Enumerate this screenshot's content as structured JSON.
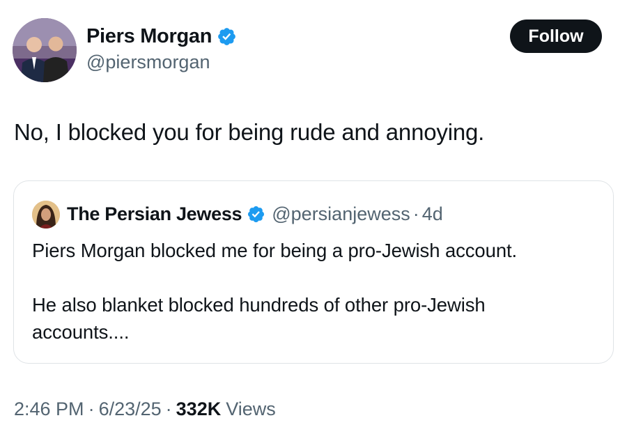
{
  "author": {
    "display_name": "Piers Morgan",
    "handle": "@piersmorgan",
    "verified": true,
    "avatar_icon": "profile-photo"
  },
  "follow_button": {
    "label": "Follow"
  },
  "tweet": {
    "text": "No, I blocked you for being rude and annoying."
  },
  "quoted_tweet": {
    "display_name": "The Persian Jewess",
    "handle": "@persianjewess",
    "separator": "·",
    "age": "4d",
    "verified": true,
    "paragraph_1": "Piers Morgan blocked me for being a pro-Jewish account.",
    "paragraph_2_line_1": "He also blanket blocked hundreds of other pro-Jewish",
    "paragraph_2_line_2": "accounts...."
  },
  "meta": {
    "time": "2:46 PM",
    "separator": "·",
    "date": "6/23/25",
    "views_count": "332K",
    "views_label": "Views"
  },
  "colors": {
    "verified_badge": "#1d9bf0",
    "secondary_text": "#536471",
    "primary_text": "#0f1419",
    "button_bg": "#0f1419",
    "border": "#dfe3e6"
  }
}
